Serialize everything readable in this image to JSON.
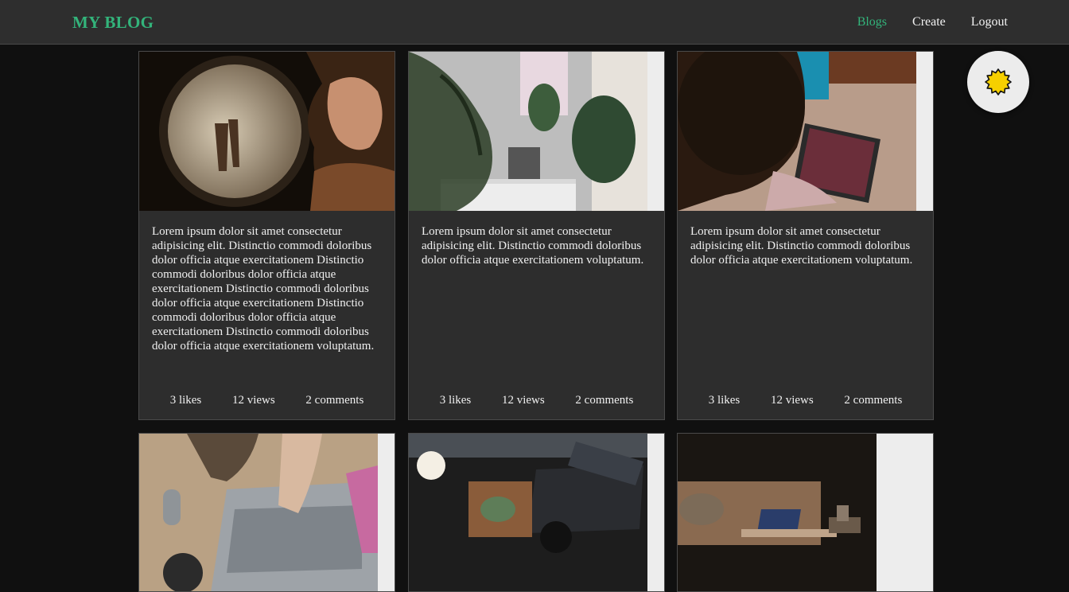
{
  "navbar": {
    "brand": "MY BLOG",
    "links": [
      {
        "label": "Blogs",
        "active": true
      },
      {
        "label": "Create",
        "active": false
      },
      {
        "label": "Logout",
        "active": false
      }
    ]
  },
  "theme_toggle": {
    "icon": "sun-icon"
  },
  "posts": [
    {
      "text": "Lorem ipsum dolor sit amet consectetur adipisicing elit. Distinctio commodi doloribus dolor officia atque exercitationem Distinctio commodi doloribus dolor officia atque exercitationem Distinctio commodi doloribus dolor officia atque exercitationem Distinctio commodi doloribus dolor officia atque exercitationem Distinctio commodi doloribus dolor officia atque exercitationem voluptatum.",
      "likes": "3 likes",
      "views": "12 views",
      "comments": "2 comments"
    },
    {
      "text": "Lorem ipsum dolor sit amet consectetur adipisicing elit. Distinctio commodi doloribus dolor officia atque exercitationem voluptatum.",
      "likes": "3 likes",
      "views": "12 views",
      "comments": "2 comments"
    },
    {
      "text": "Lorem ipsum dolor sit amet consectetur adipisicing elit. Distinctio commodi doloribus dolor officia atque exercitationem voluptatum.",
      "likes": "3 likes",
      "views": "12 views",
      "comments": "2 comments"
    }
  ]
}
